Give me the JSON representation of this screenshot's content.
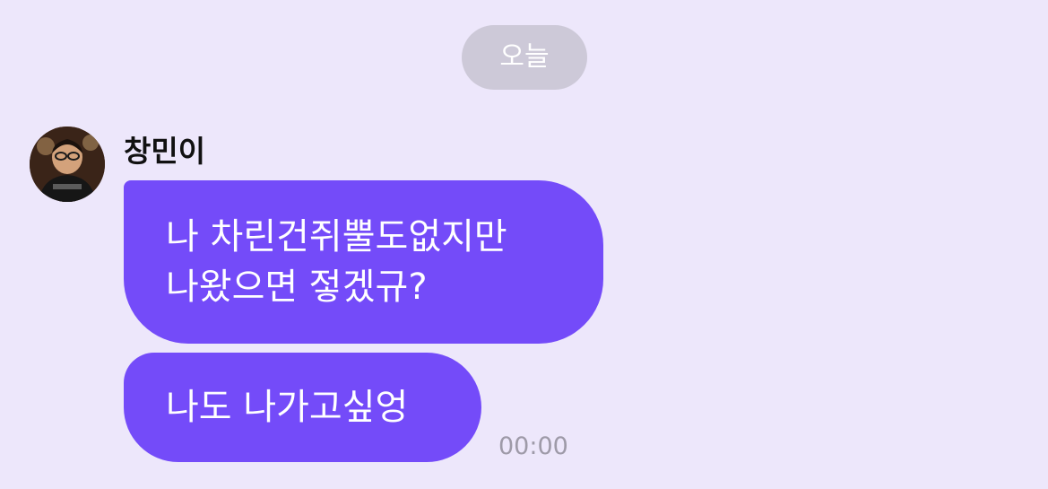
{
  "date_divider": {
    "label": "오늘"
  },
  "sender": {
    "name": "창민이",
    "avatar_icon": "profile-photo"
  },
  "messages": [
    {
      "lines": [
        "나 차린건쥐뿔도없지만",
        "나왔으면 젛겠규?"
      ]
    },
    {
      "lines": [
        "나도 나가고싶엉"
      ],
      "time": "00:00"
    }
  ],
  "colors": {
    "background": "#ede7fb",
    "bubble": "#744bf9",
    "date_pill": "#cdc9d8",
    "timestamp": "#9e9aa8"
  }
}
